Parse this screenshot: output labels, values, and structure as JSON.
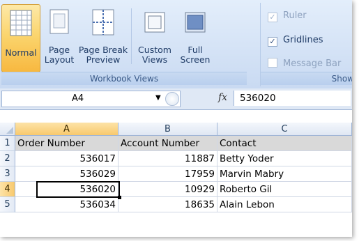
{
  "ribbon": {
    "views": [
      {
        "label": "Normal",
        "active": true,
        "icon": "normal-view-icon"
      },
      {
        "label": "Page\nLayout",
        "active": false,
        "icon": "page-layout-icon"
      },
      {
        "label": "Page Break\nPreview",
        "active": false,
        "icon": "page-break-preview-icon"
      },
      {
        "label": "Custom\nViews",
        "active": false,
        "icon": "custom-views-icon"
      },
      {
        "label": "Full\nScreen",
        "active": false,
        "icon": "full-screen-icon"
      }
    ],
    "views_group_label": "Workbook Views",
    "show_group_label": "Show",
    "show_options": [
      {
        "label": "Ruler",
        "checked": true,
        "enabled": false
      },
      {
        "label": "Gridlines",
        "checked": true,
        "enabled": true
      },
      {
        "label": "Message Bar",
        "checked": false,
        "enabled": false
      }
    ]
  },
  "formula_bar": {
    "name_box": "A4",
    "fx_label": "fx",
    "value": "536020"
  },
  "sheet": {
    "columns": [
      "A",
      "B",
      "C"
    ],
    "rows": [
      {
        "num": "1",
        "cells": [
          "Order Number",
          "Account Number",
          "Contact"
        ]
      },
      {
        "num": "2",
        "cells": [
          "536017",
          "11887",
          "Betty Yoder"
        ]
      },
      {
        "num": "3",
        "cells": [
          "536029",
          "17959",
          "Marvin Mabry"
        ]
      },
      {
        "num": "4",
        "cells": [
          "536020",
          "10929",
          "Roberto Gil"
        ]
      },
      {
        "num": "5",
        "cells": [
          "536034",
          "18635",
          "Alain Lebon"
        ]
      }
    ],
    "active_cell": "A4",
    "header_fill": "#d9d9d9",
    "selection_color": "#f8c96d"
  }
}
